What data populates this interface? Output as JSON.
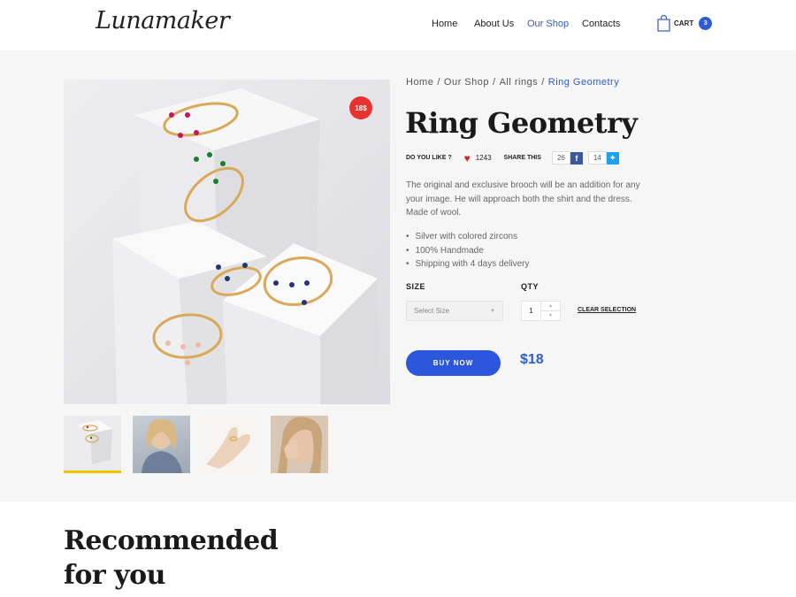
{
  "header": {
    "logo": "Lunamaker",
    "nav": [
      {
        "label": "Home",
        "active": false
      },
      {
        "label": "About Us",
        "active": false
      },
      {
        "label": "Our Shop",
        "active": true
      },
      {
        "label": "Contacts",
        "active": false
      }
    ],
    "cart_label": "CART",
    "cart_count": "3"
  },
  "product": {
    "price_badge": "18$",
    "breadcrumb": [
      "Home",
      "Our Shop",
      "All rings",
      "Ring Geometry"
    ],
    "title": "Ring Geometry",
    "like_label": "DO YOU LIKE ?",
    "likes": "1243",
    "share_label": "SHARE THIS",
    "facebook_count": "26",
    "twitter_count": "14",
    "description": "The original and exclusive brooch will be an addition for any your image. He will approach both the shirt and the dress. Made of wool.",
    "features": [
      "Silver with colored zircons",
      "100% Handmade",
      "Shipping with 4 days delivery"
    ],
    "size_label": "SIZE",
    "size_placeholder": "Select Size",
    "qty_label": "QTY",
    "qty_value": "1",
    "clear_label": "CLEAR SELECTION",
    "buy_label": "BUY NOW",
    "price": "$18"
  },
  "recommended": {
    "line1": "Recommended",
    "line2": "for you"
  },
  "colors": {
    "accent": "#2e5bd6",
    "badge": "#e8332f",
    "thumb_indicator": "#f2c500"
  }
}
